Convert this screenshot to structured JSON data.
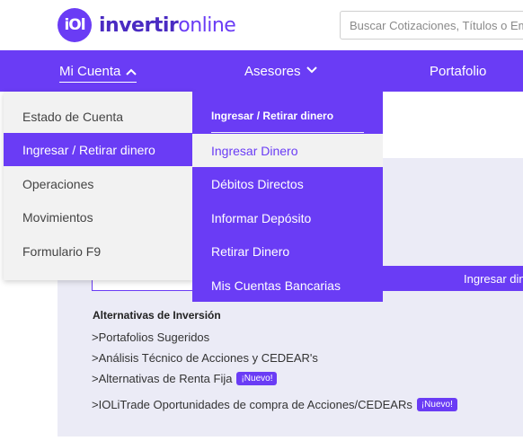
{
  "header": {
    "logo_badge": "iOl",
    "logo_text_strong": "invertir",
    "logo_text_light": "online",
    "search_placeholder": "Buscar Cotizaciones, Títulos o Em"
  },
  "nav": {
    "mi_cuenta": "Mi Cuenta",
    "asesores": "Asesores",
    "portafolio": "Portafolio"
  },
  "mi_cuenta_menu": [
    {
      "label": "Estado de Cuenta"
    },
    {
      "label": "Ingresar / Retirar dinero"
    },
    {
      "label": "Operaciones"
    },
    {
      "label": "Movimientos"
    },
    {
      "label": "Formulario F9"
    }
  ],
  "submenu": {
    "title": "Ingresar / Retirar dinero",
    "items": [
      {
        "label": "Ingresar Dinero"
      },
      {
        "label": "Débitos Directos"
      },
      {
        "label": "Informar Depósito"
      },
      {
        "label": "Retirar Dinero"
      },
      {
        "label": "Mis Cuentas Bancarias"
      }
    ]
  },
  "panel": {
    "ingresar_btn": "Ingresar dinero",
    "alternativas_title": "Alternativas de Inversión",
    "links": [
      {
        "label": ">Portafolios Sugeridos",
        "badge": ""
      },
      {
        "label": ">Análisis Técnico de Acciones y CEDEAR's",
        "badge": ""
      },
      {
        "label": ">Alternativas de Renta Fija",
        "badge": "¡Nuevo!"
      },
      {
        "label": ">IOLiTrade Oportunidades de compra de Acciones/CEDEARs",
        "badge": "¡Nuevo!"
      }
    ]
  },
  "colors": {
    "accent": "#6a3cf5",
    "menu_bg": "#f2f2f2",
    "panel_bg": "#ebebf6"
  }
}
